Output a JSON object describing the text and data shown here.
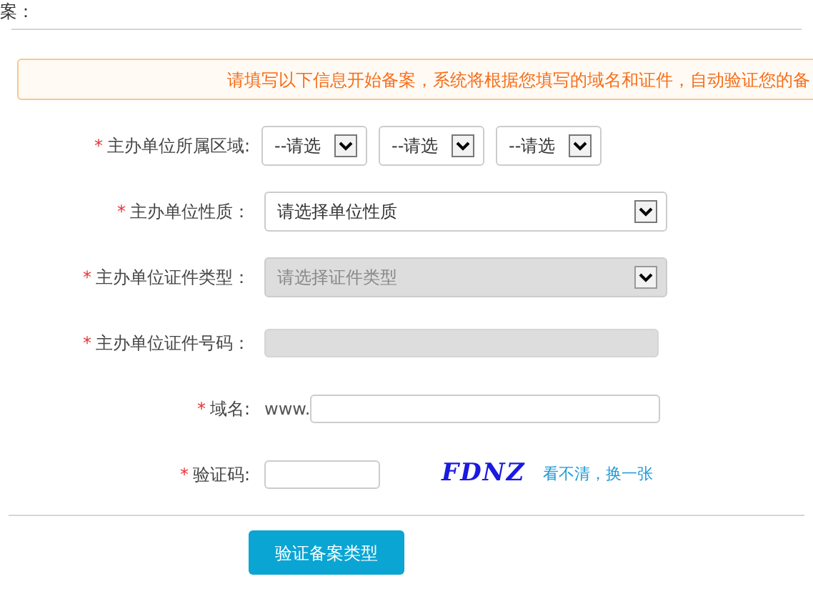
{
  "heading": "案：",
  "notice": "请填写以下信息开始备案，系统将根据您填写的域名和证件，自动验证您的备",
  "fields": [
    {
      "kind": "region",
      "label": "主办单位所属区域:",
      "required_mark": "*",
      "selects": [
        "--请选",
        "--请选",
        "--请选"
      ]
    },
    {
      "kind": "select",
      "label": "主办单位性质：",
      "required_mark": "*",
      "value": "请选择单位性质",
      "disabled": false
    },
    {
      "kind": "select",
      "label": "主办单位证件类型：",
      "required_mark": "*",
      "value": "请选择证件类型",
      "disabled": true
    },
    {
      "kind": "text",
      "label": "主办单位证件号码：",
      "required_mark": "*",
      "disabled": true
    },
    {
      "kind": "domain",
      "label": "域名:",
      "required_mark": "*",
      "prefix": "www.",
      "disabled": false
    },
    {
      "kind": "captcha",
      "label": "验证码:",
      "required_mark": "*",
      "captcha": "FDNZ",
      "refresh": "看不清，换一张"
    }
  ],
  "submit": "验证备案类型"
}
